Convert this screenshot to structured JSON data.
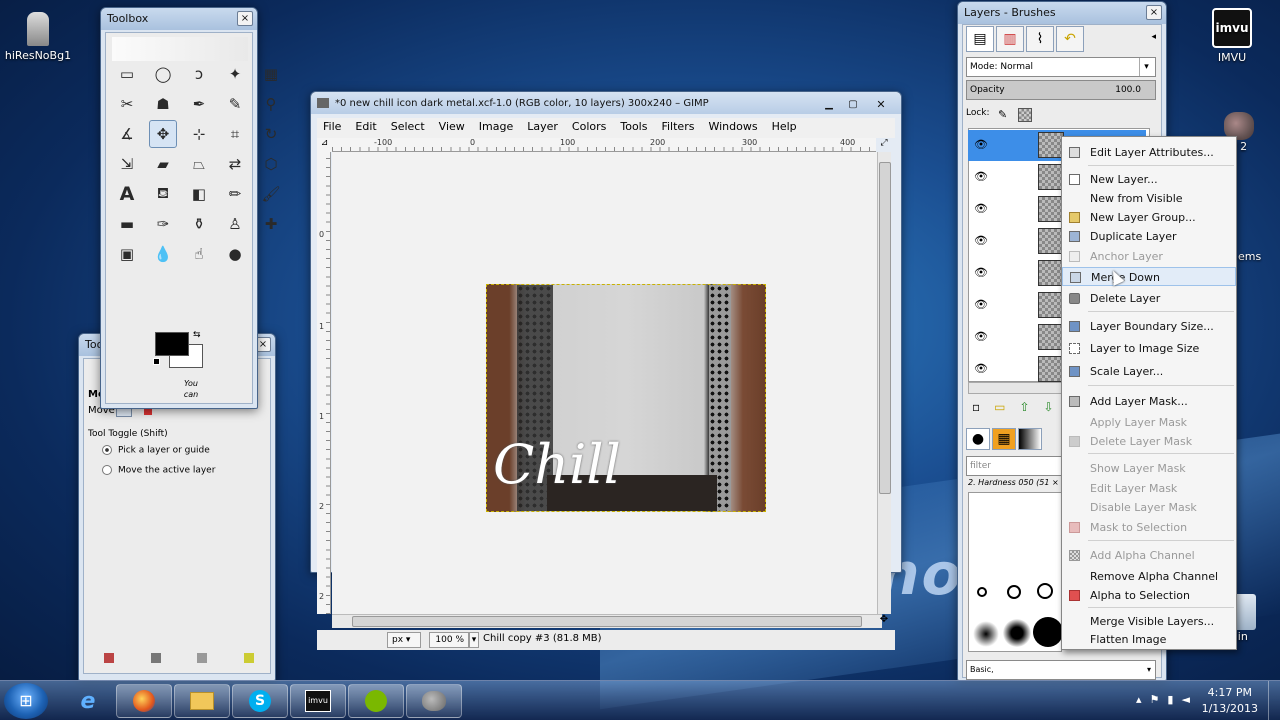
{
  "desktop": {
    "icons": [
      {
        "label": "hiResNoBg1"
      },
      {
        "label": "IMVU"
      }
    ],
    "partial_labels": [
      "P 2",
      "ems",
      "e Bin"
    ],
    "brand": "leno"
  },
  "toolbox": {
    "title": "Toolbox",
    "close": "×",
    "hint": "You can"
  },
  "tool_options": {
    "title_fragment": "Too",
    "mode_fragment": "Mo",
    "move_label": "Move:",
    "toggle_label": "Tool Toggle  (Shift)",
    "options": [
      {
        "label": "Pick a layer or guide",
        "selected": true
      },
      {
        "label": "Move the active layer",
        "selected": false
      }
    ]
  },
  "gimp": {
    "title": "*0 new chill icon dark metal.xcf-1.0 (RGB color, 10 layers) 300x240 – GIMP",
    "menu": [
      "File",
      "Edit",
      "Select",
      "View",
      "Image",
      "Layer",
      "Colors",
      "Tools",
      "Filters",
      "Windows",
      "Help"
    ],
    "ruler_h": [
      "-100",
      "0",
      "100",
      "200",
      "300",
      "400"
    ],
    "ruler_v": [
      "0",
      "1",
      "1",
      "2",
      "2"
    ],
    "image_text": "Chill",
    "unit": "px",
    "zoom": "100 %",
    "status": "Chill copy #3 (81.8 MB)"
  },
  "layers": {
    "title": "Layers - Brushes",
    "close": "×",
    "mode_label": "Mode: Normal",
    "opacity_label": "Opacity",
    "opacity_value": "100.0",
    "lock_label": "Lock:",
    "filter_placeholder": "filter",
    "brush_name": "2. Hardness 050 (51 × 5",
    "preset": "Basic,"
  },
  "context_menu": {
    "items": [
      {
        "label": "Edit Layer Attributes...",
        "disabled": false
      },
      {
        "label": "New Layer...",
        "disabled": false
      },
      {
        "label": "New from Visible",
        "disabled": false
      },
      {
        "label": "New Layer Group...",
        "disabled": false
      },
      {
        "label": "Duplicate Layer",
        "disabled": false
      },
      {
        "label": "Anchor Layer",
        "disabled": true
      },
      {
        "label": "Merge Down",
        "disabled": false
      },
      {
        "label": "Delete Layer",
        "disabled": false
      },
      {
        "label": "Layer Boundary Size...",
        "disabled": false
      },
      {
        "label": "Layer to Image Size",
        "disabled": false
      },
      {
        "label": "Scale Layer...",
        "disabled": false
      },
      {
        "label": "Add Layer Mask...",
        "disabled": false
      },
      {
        "label": "Apply Layer Mask",
        "disabled": true
      },
      {
        "label": "Delete Layer Mask",
        "disabled": true
      },
      {
        "label": "Show Layer Mask",
        "disabled": true
      },
      {
        "label": "Edit Layer Mask",
        "disabled": true
      },
      {
        "label": "Disable Layer Mask",
        "disabled": true
      },
      {
        "label": "Mask to Selection",
        "disabled": true
      },
      {
        "label": "Add Alpha Channel",
        "disabled": true
      },
      {
        "label": "Remove Alpha Channel",
        "disabled": false
      },
      {
        "label": "Alpha to Selection",
        "disabled": false
      },
      {
        "label": "Merge Visible Layers...",
        "disabled": false
      },
      {
        "label": "Flatten Image",
        "disabled": false
      }
    ]
  },
  "taskbar": {
    "time": "4:17 PM",
    "date": "1/13/2013"
  }
}
